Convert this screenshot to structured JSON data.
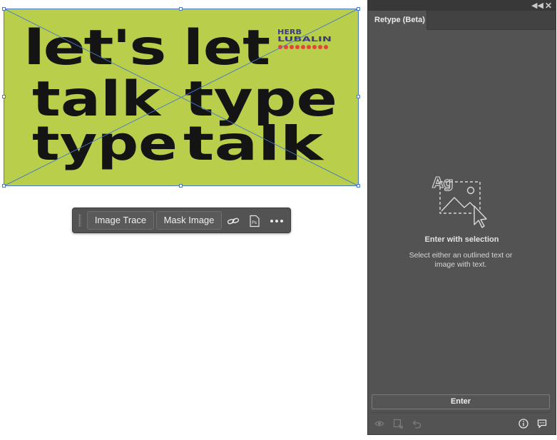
{
  "artwork": {
    "lines": [
      [
        "let's",
        "let"
      ],
      [
        "talk",
        "type"
      ],
      [
        "type",
        "talk"
      ]
    ],
    "logo_lines": [
      "HERB",
      "LUBALIN"
    ],
    "background_color": "#b9cf4c",
    "text_color": "#141414",
    "logo_color": "#3d3a8c",
    "logo_accent_color": "#e0463c",
    "selection_color": "#4a78c2"
  },
  "task_bar": {
    "image_trace_label": "Image Trace",
    "mask_image_label": "Mask Image",
    "link_icon": "link-icon",
    "photoshop_icon": "photoshop-icon",
    "photoshop_icon_text": "Ps",
    "more_icon": "more-options-icon"
  },
  "panel": {
    "tab_label": "Retype (Beta)",
    "collapse_icon": "collapse-double-chevron-icon",
    "close_icon": "close-icon",
    "empty_state": {
      "illustration_text": "Ag",
      "title": "Enter with selection",
      "description": "Select either an outlined text or image with text."
    },
    "enter_button_label": "Enter",
    "footer_icons": [
      "visibility-icon",
      "export-icon",
      "undo-icon",
      "info-icon",
      "feedback-icon"
    ]
  }
}
